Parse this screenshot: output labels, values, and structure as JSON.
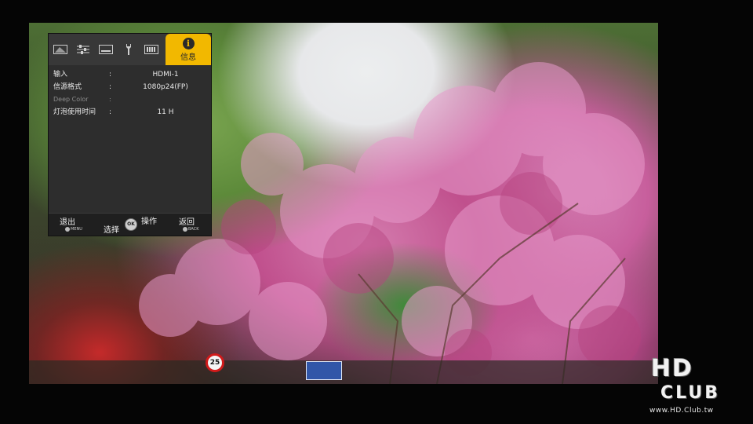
{
  "osd": {
    "tabs": [
      {
        "icon": "picture-adjust-icon"
      },
      {
        "icon": "sliders-icon"
      },
      {
        "icon": "input-signal-icon"
      },
      {
        "icon": "installation-tool-icon"
      },
      {
        "icon": "display-setup-icon"
      }
    ],
    "active_tab": {
      "icon": "info-icon",
      "glyph": "i",
      "label": "信息"
    },
    "rows": [
      {
        "label": "输入",
        "colon": ":",
        "value": "HDMI-1"
      },
      {
        "label": "信源格式",
        "colon": ":",
        "value": "1080p24(FP)"
      },
      {
        "label": "Deep Color",
        "colon": ":",
        "value": ""
      },
      {
        "label": "灯泡使用时间",
        "colon": ":",
        "value": "11 H"
      }
    ],
    "footer": {
      "exit_label": "退出",
      "exit_key": "MENU",
      "select_label": "选择",
      "dial_label": "OK",
      "operate_label": "操作",
      "back_label": "返回",
      "back_key": "BACK"
    }
  },
  "scene": {
    "speed_sign": "25"
  },
  "watermark": {
    "line1": "HD",
    "line2": "CLUB",
    "url": "www.HD.Club.tw"
  },
  "colors": {
    "osd_background": "#2d2d2d",
    "active_tab": "#f2b800",
    "text": "#e8e8e8"
  }
}
